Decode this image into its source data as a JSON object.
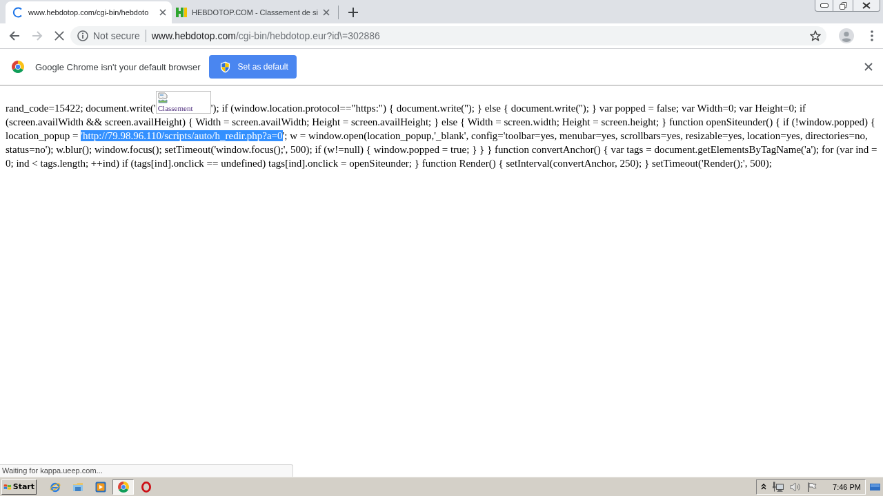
{
  "tabs": [
    {
      "title": "www.hebdotop.com/cgi-bin/hebdoto",
      "selected": true,
      "loading": true
    },
    {
      "title": "HEBDOTOP.COM - Classement de si",
      "selected": false,
      "loading": false
    }
  ],
  "toolbar": {
    "forward_disabled": true,
    "loading": true,
    "security_label": "Not secure",
    "url_host": "www.hebdotop.com",
    "url_path": "/cgi-bin/hebdotop.eur?id\\=302886"
  },
  "infobar": {
    "message": "Google Chrome isn't your default browser",
    "button": "Set as default"
  },
  "page": {
    "lines": [
      [
        {
          "kind": "text",
          "text": "rand_code=15422; document.write('"
        },
        {
          "kind": "image",
          "alt": "Classement"
        },
        {
          "kind": "text",
          "text": "'); if (window.location.protocol==\"https:\") { document.write(''); } else { document.write(''); } var popped = false; var Width=0; var Height=0; if"
        }
      ],
      [
        {
          "kind": "text",
          "text": "(screen.availWidth && screen.availHeight) { Width = screen.availWidth; Height = screen.availHeight; } else { Width = screen.width; Height = screen.height; } function openSiteunder() { if (!window.popped) {"
        }
      ],
      [
        {
          "kind": "text",
          "text": "location_popup = "
        },
        {
          "kind": "selection",
          "text": "'http://79.98.96.110/scripts/auto/h_redir.php?a=0"
        },
        {
          "kind": "text",
          "text": "'; w = window.open(location_popup,'_blank', config='toolbar=yes, menubar=yes, scrollbars=yes, resizable=yes, location=yes, directories=no,"
        }
      ],
      [
        {
          "kind": "text",
          "text": "status=no'); w.blur(); window.focus(); setTimeout('window.focus();', 500); if (w!=null) { window.popped = true; } } } function convertAnchor() { var tags = document.getElementsByTagName('a'); for (var ind ="
        }
      ],
      [
        {
          "kind": "text",
          "text": "0; ind < tags.length; ++ind) if (tags[ind].onclick == undefined) tags[ind].onclick = openSiteunder; } function Render() { setInterval(convertAnchor, 250); } setTimeout('Render();', 500);"
        }
      ]
    ]
  },
  "status_bubble": {
    "text": "Waiting for kappa.ueep.com..."
  },
  "taskbar": {
    "start_label": "Start",
    "apps": [
      {
        "kind": "ie",
        "selected": false
      },
      {
        "kind": "explorer",
        "selected": false
      },
      {
        "kind": "media",
        "selected": false
      },
      {
        "kind": "chrome",
        "selected": true
      },
      {
        "kind": "opera",
        "selected": false
      }
    ],
    "clock": "7:46 PM"
  }
}
